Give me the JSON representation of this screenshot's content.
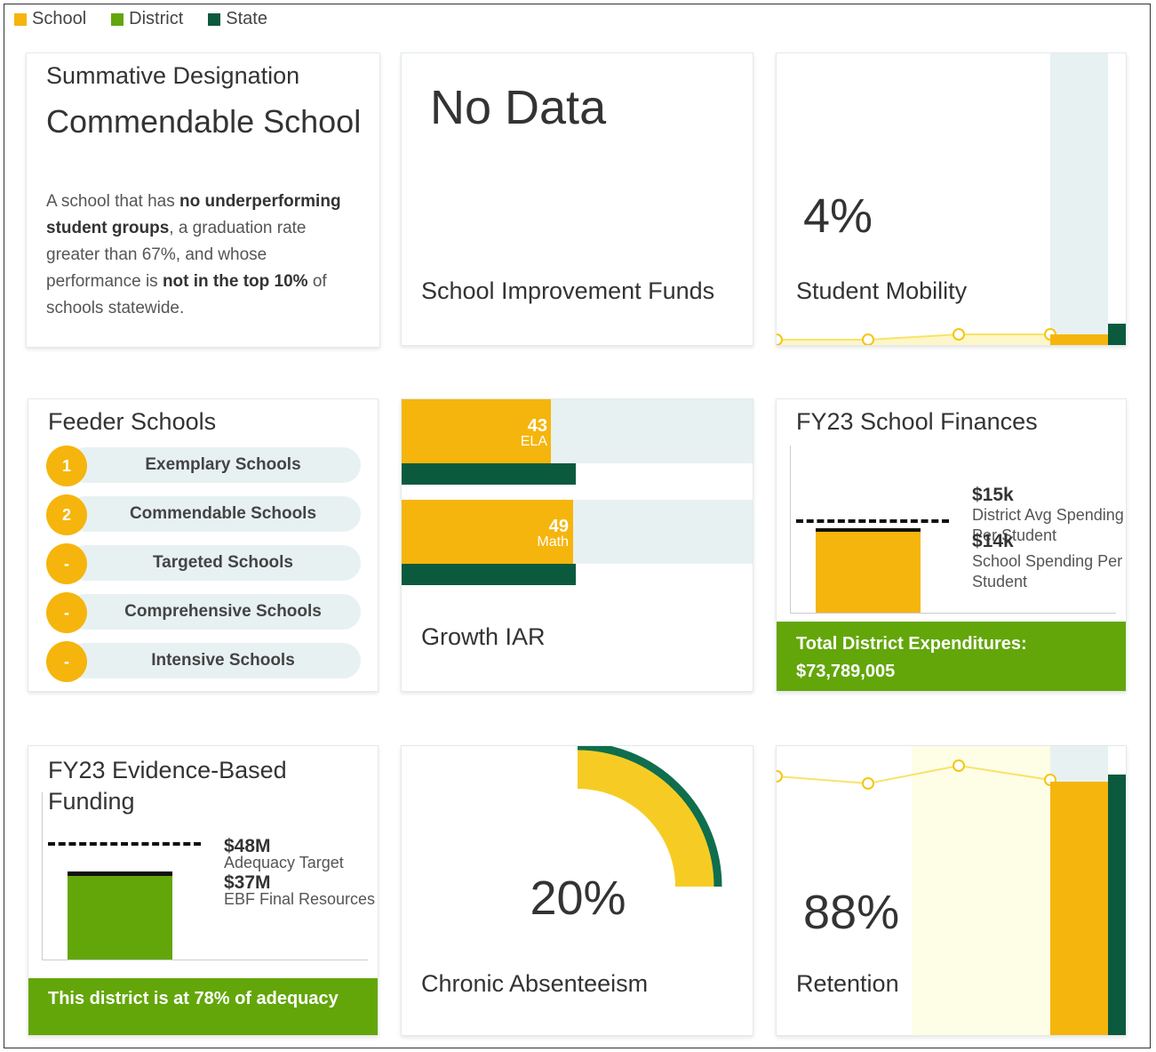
{
  "legend": [
    {
      "label": "School",
      "color": "#f5b50c"
    },
    {
      "label": "District",
      "color": "#63a60a"
    },
    {
      "label": "State",
      "color": "#0b5a3e"
    }
  ],
  "summative": {
    "title": "Summative Designation",
    "value": "Commendable School",
    "desc_1": "A school that has ",
    "desc_bold_1": "no underperforming student groups",
    "desc_2": ", a graduation rate greater than 67%, and whose performance is ",
    "desc_bold_2": "not in the top 10%",
    "desc_3": " of schools statewide."
  },
  "improvement": {
    "value": "No Data",
    "label": "School Improvement Funds"
  },
  "mobility": {
    "value": "4%",
    "label": "Student Mobility"
  },
  "feeder": {
    "title": "Feeder Schools",
    "rows": [
      {
        "count": "1",
        "label": "Exemplary Schools"
      },
      {
        "count": "2",
        "label": "Commendable Schools"
      },
      {
        "count": "-",
        "label": "Targeted Schools"
      },
      {
        "count": "-",
        "label": "Comprehensive Schools"
      },
      {
        "count": "-",
        "label": "Intensive Schools"
      }
    ]
  },
  "growth": {
    "label": "Growth IAR",
    "bars": [
      {
        "subject": "ELA",
        "school": 43,
        "state": 50
      },
      {
        "subject": "Math",
        "school": 49,
        "state": 50
      }
    ]
  },
  "finances": {
    "title": "FY23 School Finances",
    "district_value": "$15k",
    "district_label": "District Avg Spending Per Student",
    "school_value": "$14k",
    "school_label": "School Spending Per Student",
    "footer_1": "Total District Expenditures:",
    "footer_2": "$73,789,005"
  },
  "ebf": {
    "title": "FY23 Evidence-Based Funding",
    "target_value": "$48M",
    "target_label": "Adequacy Target",
    "resources_value": "$37M",
    "resources_label": "EBF Final Resources",
    "footer": "This district is at 78% of adequacy"
  },
  "absenteeism": {
    "value": "20%",
    "label": "Chronic Absenteeism"
  },
  "retention": {
    "value": "88%",
    "label": "Retention"
  }
}
